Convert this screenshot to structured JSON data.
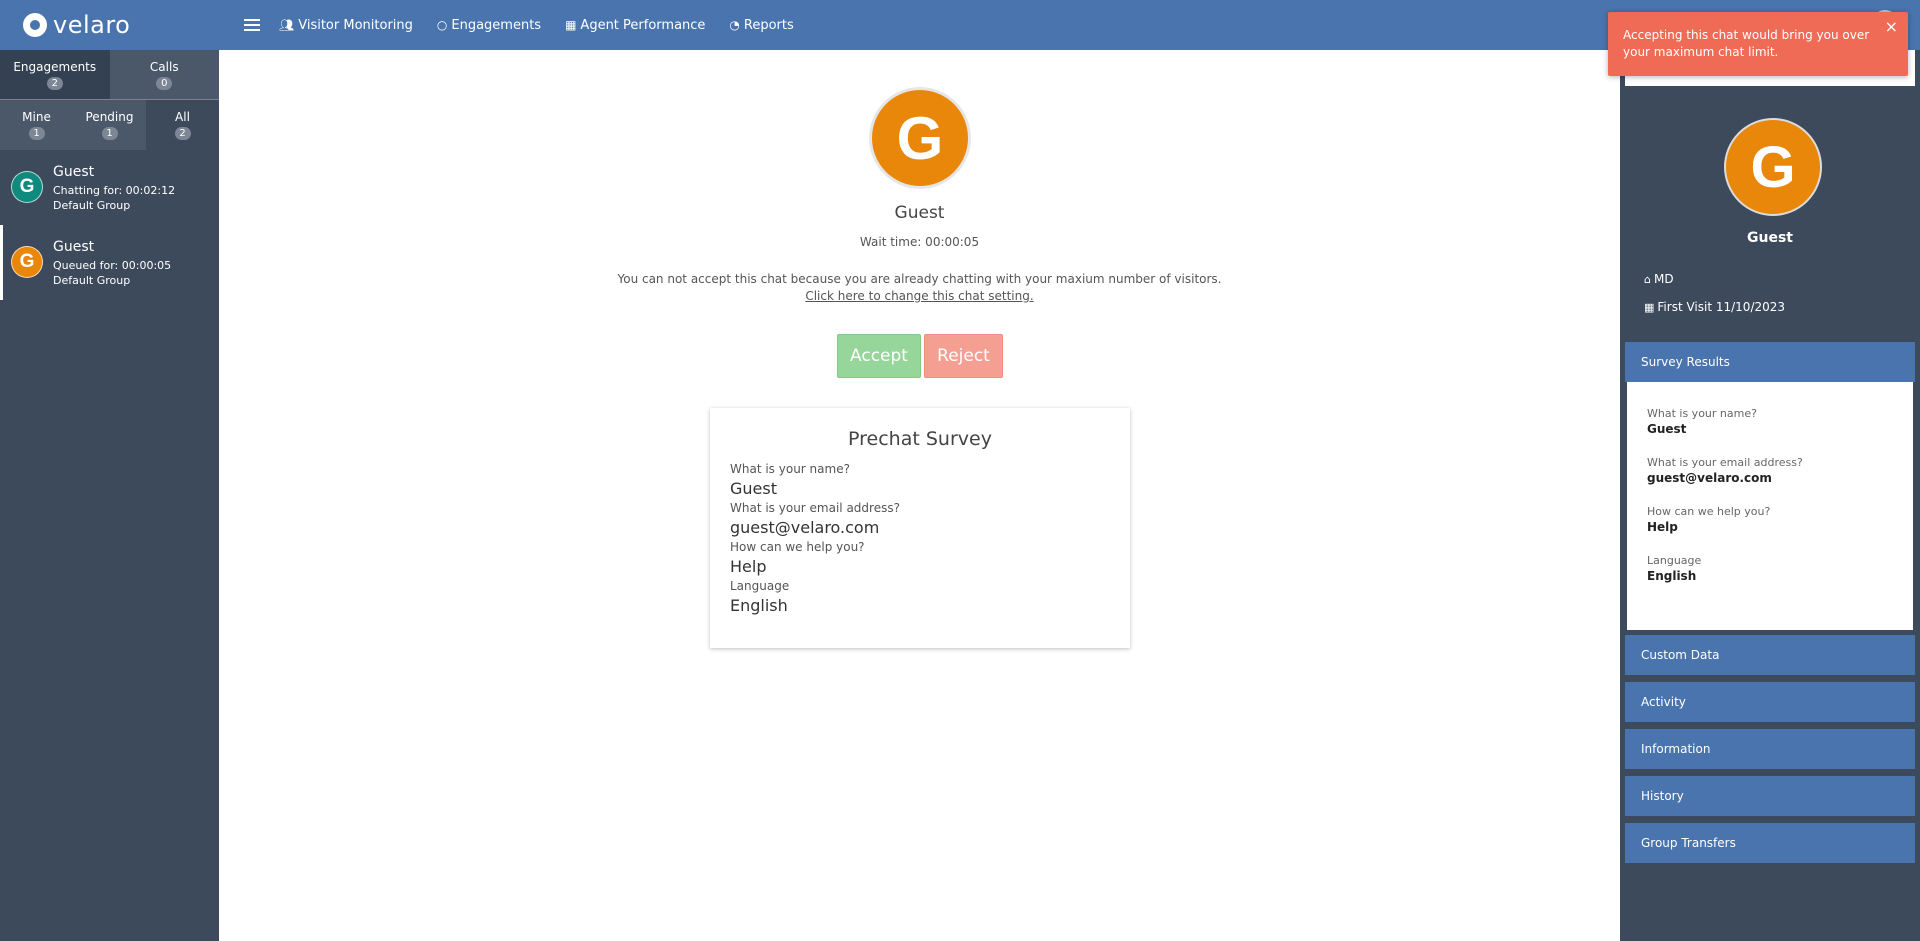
{
  "app": {
    "brand": "velaro",
    "nav": [
      {
        "icon": "users-icon",
        "label": "Visitor Monitoring"
      },
      {
        "icon": "chat-bubble-icon",
        "label": "Engagements"
      },
      {
        "icon": "grid-icon",
        "label": "Agent Performance"
      },
      {
        "icon": "pie-chart-icon",
        "label": "Reports"
      }
    ]
  },
  "sidebar": {
    "tabs": [
      {
        "label": "Engagements",
        "count": "2"
      },
      {
        "label": "Calls",
        "count": "0"
      }
    ],
    "subtabs": [
      {
        "label": "Mine",
        "count": "1"
      },
      {
        "label": "Pending",
        "count": "1"
      },
      {
        "label": "All",
        "count": "2"
      }
    ],
    "chats": [
      {
        "initial": "G",
        "name": "Guest",
        "status": "Chatting for: 00:02:12",
        "group": "Default Group",
        "color": "#0e8a7e"
      },
      {
        "initial": "G",
        "name": "Guest",
        "status": "Queued for: 00:00:05",
        "group": "Default Group",
        "color": "#e8870a"
      }
    ]
  },
  "main": {
    "avatar_initial": "G",
    "name": "Guest",
    "wait": "Wait time: 00:00:05",
    "message": "You can not accept this chat because you are already chatting with your maxium number of visitors.",
    "link": "Click here to change this chat setting.",
    "accept_label": "Accept",
    "reject_label": "Reject",
    "survey": {
      "title": "Prechat Survey",
      "items": [
        {
          "q": "What is your name?",
          "a": "Guest"
        },
        {
          "q": "What is your email address?",
          "a": "guest@velaro.com"
        },
        {
          "q": "How can we help you?",
          "a": "Help"
        },
        {
          "q": "Language",
          "a": "English"
        }
      ]
    }
  },
  "right": {
    "avatar_initial": "G",
    "name": "Guest",
    "location": "MD",
    "first_visit": "First Visit 11/10/2023",
    "survey_header": "Survey Results",
    "survey_items": [
      {
        "q": "What is your name?",
        "a": "Guest"
      },
      {
        "q": "What is your email address?",
        "a": "guest@velaro.com"
      },
      {
        "q": "How can we help you?",
        "a": "Help"
      },
      {
        "q": "Language",
        "a": "English"
      }
    ],
    "sections": [
      "Custom Data",
      "Activity",
      "Information",
      "History",
      "Group Transfers"
    ]
  },
  "toast": {
    "message": "Accepting this chat would bring you over your maximum chat limit.",
    "close": "×"
  },
  "colors": {
    "brand_blue": "#4a74ad",
    "sidebar_dark": "#3d4a5c",
    "accept_green": "#97d69a",
    "reject_red": "#f59f92",
    "toast_red": "#f06b55",
    "avatar_orange": "#e8870a",
    "avatar_teal": "#0e8a7e"
  }
}
